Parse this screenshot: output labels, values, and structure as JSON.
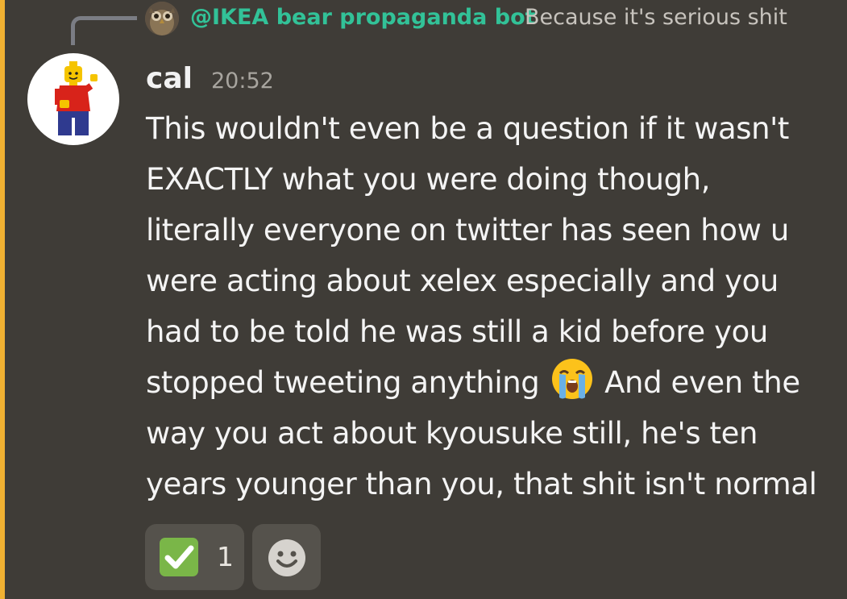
{
  "reply": {
    "author": "@IKEA bear propaganda bot",
    "text": "Because it's serious shit"
  },
  "message": {
    "author": "cal",
    "timestamp": "20:52",
    "line1": "This wouldn't even be a question if it wasn't",
    "line2": "EXACTLY what you were doing though,",
    "line3": "literally everyone on twitter has seen how u",
    "line4": "were acting about xelex especially and you",
    "line5": "had to be told he was still a kid before you",
    "line6a": "stopped tweeting anything",
    "line6b": " And even the",
    "line7": "way you act about kyousuke still, he's ten",
    "line8": "years younger than you, that shit isn't normal",
    "emoji": "loudly-crying-face"
  },
  "reactions": [
    {
      "icon": "check-mark-button-icon",
      "count": "1"
    }
  ],
  "add_reaction_icon": "smiley-add-reaction-icon",
  "colors": {
    "background": "#3f3c37",
    "mention_bar": "#f0b132",
    "reply_author": "#32c298"
  }
}
